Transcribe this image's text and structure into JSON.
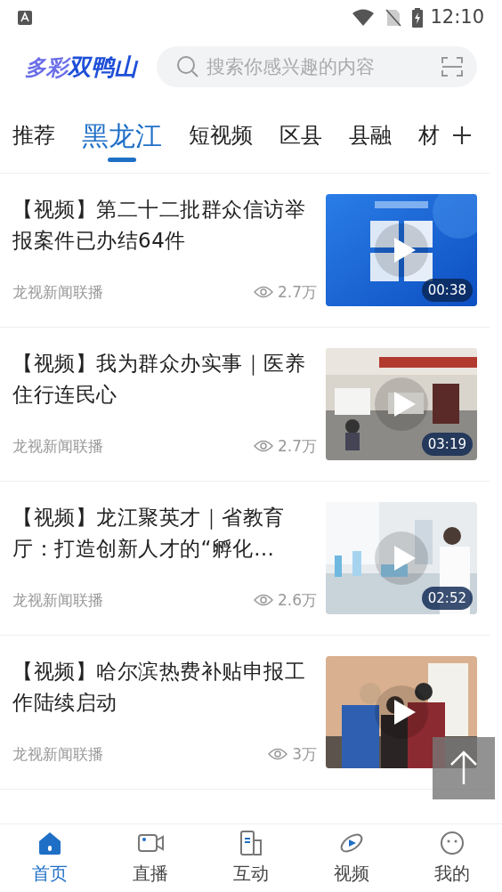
{
  "status_bar": {
    "time": "12:10"
  },
  "header": {
    "logo_light": "多彩",
    "logo_bold": "双鸭山",
    "search": {
      "placeholder": "搜索你感兴趣的内容"
    }
  },
  "tabs": [
    {
      "label": "推荐",
      "selected": false
    },
    {
      "label": "黑龙江",
      "selected": true
    },
    {
      "label": "短视频",
      "selected": false
    },
    {
      "label": "区县",
      "selected": false
    },
    {
      "label": "县融",
      "selected": false
    },
    {
      "label": "材",
      "selected": false
    }
  ],
  "articles": [
    {
      "title": "【视频】第二十二批群众信访举报案件已办结64件",
      "source": "龙视新闻联播",
      "views": "2.7万",
      "duration": "00:38"
    },
    {
      "title": "【视频】我为群众办实事｜医养住行连民心",
      "source": "龙视新闻联播",
      "views": "2.7万",
      "duration": "03:19"
    },
    {
      "title": "【视频】龙江聚英才｜省教育厅：打造创新人才的“孵化…",
      "source": "龙视新闻联播",
      "views": "2.6万",
      "duration": "02:52"
    },
    {
      "title": "【视频】哈尔滨热费补贴申报工作陆续启动",
      "source": "龙视新闻联播",
      "views": "3万"
    }
  ],
  "bottom_nav": [
    {
      "label": "首页",
      "selected": true,
      "kind": "home"
    },
    {
      "label": "直播",
      "selected": false,
      "kind": "live"
    },
    {
      "label": "互动",
      "selected": false,
      "kind": "interact"
    },
    {
      "label": "视频",
      "selected": false,
      "kind": "video"
    },
    {
      "label": "我的",
      "selected": false,
      "kind": "me"
    }
  ]
}
